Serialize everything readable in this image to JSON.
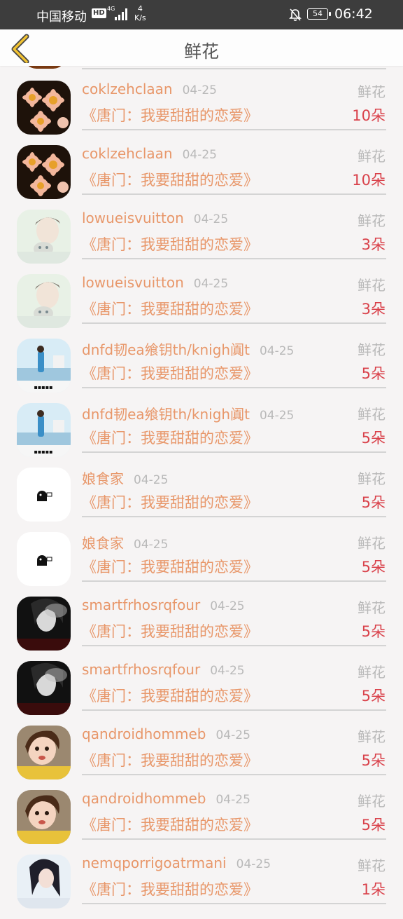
{
  "status_bar": {
    "carrier": "中国移动",
    "hd": "HD",
    "network": "4G",
    "speed_value": "4",
    "speed_unit": "K/s",
    "battery": "54",
    "time": "06:42"
  },
  "header": {
    "title": "鲜花",
    "back_icon": "chevron-left-icon"
  },
  "colors": {
    "accent": "#e8976a",
    "count": "#d9414a",
    "muted": "#b9b9b9"
  },
  "records": [
    {
      "user": "coklzehclaan",
      "date": "04-25",
      "type": "鲜花",
      "book": "《唐门：我要甜甜的恋爱》",
      "count": "10朵",
      "avatar": "flower"
    },
    {
      "user": "coklzehclaan",
      "date": "04-25",
      "type": "鲜花",
      "book": "《唐门：我要甜甜的恋爱》",
      "count": "10朵",
      "avatar": "flower"
    },
    {
      "user": "lowueisvuitton",
      "date": "04-25",
      "type": "鲜花",
      "book": "《唐门：我要甜甜的恋爱》",
      "count": "3朵",
      "avatar": "man-cat"
    },
    {
      "user": "lowueisvuitton",
      "date": "04-25",
      "type": "鲜花",
      "book": "《唐门：我要甜甜的恋爱》",
      "count": "3朵",
      "avatar": "man-cat"
    },
    {
      "user": "dnfd韧ea飨钥th/knigh阗t",
      "date": "04-25",
      "type": "鲜花",
      "book": "《唐门：我要甜甜的恋爱》",
      "count": "5朵",
      "avatar": "beach"
    },
    {
      "user": "dnfd韧ea飨钥th/knigh阗t",
      "date": "04-25",
      "type": "鲜花",
      "book": "《唐门：我要甜甜的恋爱》",
      "count": "5朵",
      "avatar": "beach"
    },
    {
      "user": "娘食家",
      "date": "04-25",
      "type": "鲜花",
      "book": "《唐门：我要甜甜的恋爱》",
      "count": "5朵",
      "avatar": "sticker"
    },
    {
      "user": "娘食家",
      "date": "04-25",
      "type": "鲜花",
      "book": "《唐门：我要甜甜的恋爱》",
      "count": "5朵",
      "avatar": "sticker"
    },
    {
      "user": "smartfrhosrqfour",
      "date": "04-25",
      "type": "鲜花",
      "book": "《唐门：我要甜甜的恋爱》",
      "count": "5朵",
      "avatar": "dark-portrait"
    },
    {
      "user": "smartfrhosrqfour",
      "date": "04-25",
      "type": "鲜花",
      "book": "《唐门：我要甜甜的恋爱》",
      "count": "5朵",
      "avatar": "dark-portrait"
    },
    {
      "user": "qandroidhommeb",
      "date": "04-25",
      "type": "鲜花",
      "book": "《唐门：我要甜甜的恋爱》",
      "count": "5朵",
      "avatar": "child"
    },
    {
      "user": "qandroidhommeb",
      "date": "04-25",
      "type": "鲜花",
      "book": "《唐门：我要甜甜的恋爱》",
      "count": "5朵",
      "avatar": "child"
    },
    {
      "user": "nemqporrigoatrmani",
      "date": "04-25",
      "type": "鲜花",
      "book": "《唐门：我要甜甜的恋爱》",
      "count": "1朵",
      "avatar": "woman"
    }
  ]
}
